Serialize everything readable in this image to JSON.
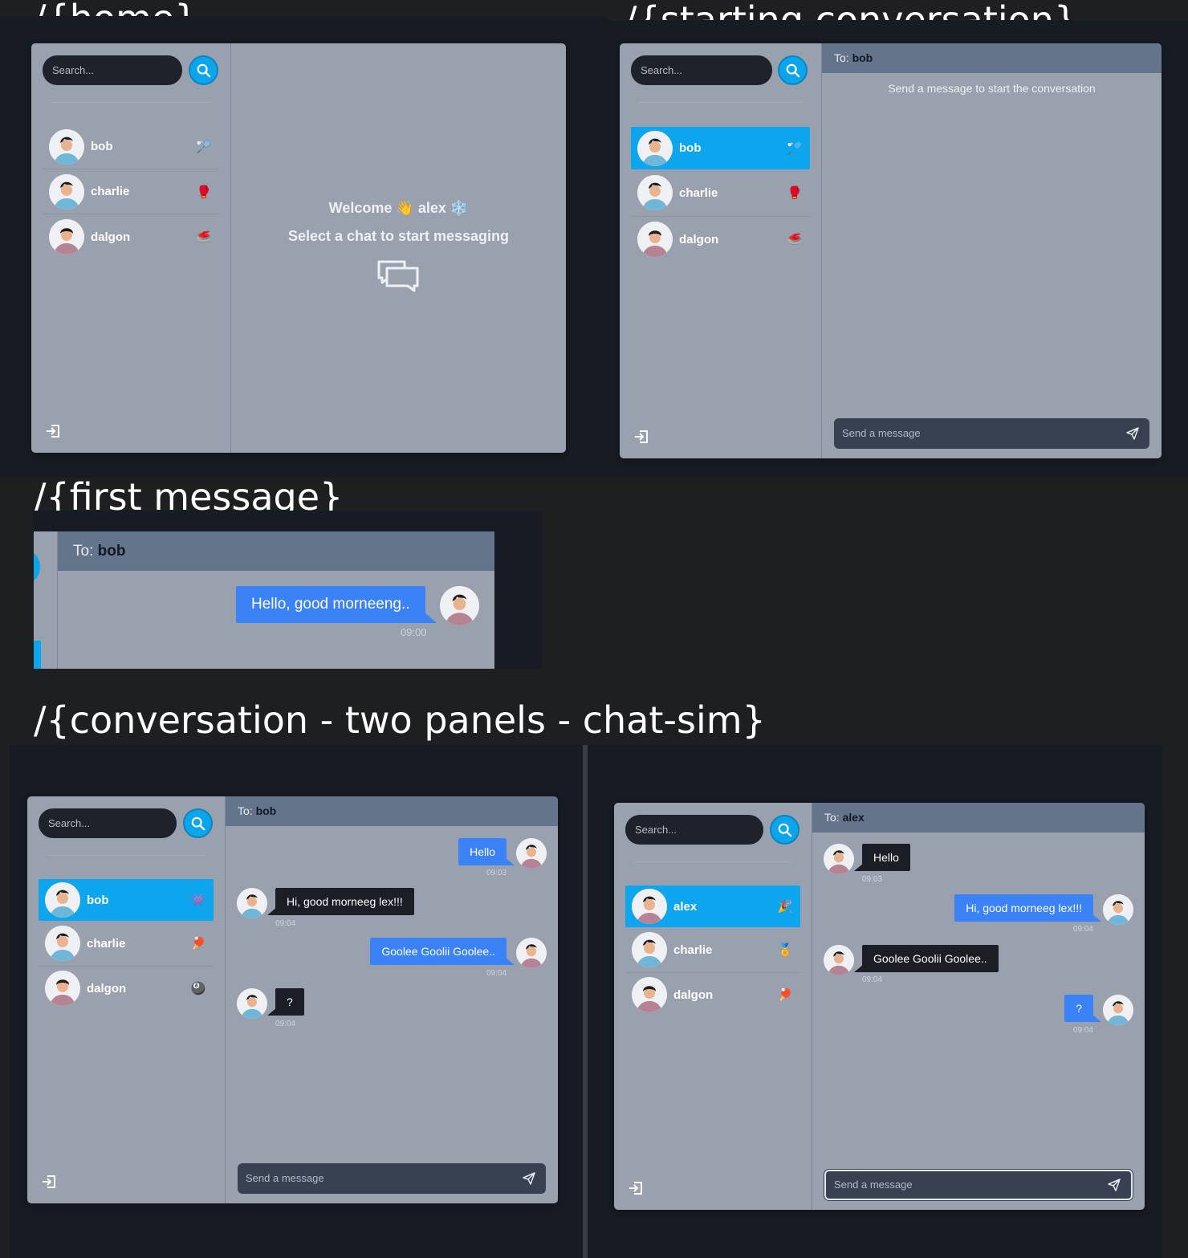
{
  "sections": {
    "home": "/{home}",
    "starting": "/{starting conversation}",
    "first": "/{first message}",
    "conversation": "/{conversation - two panels - chat-sim}"
  },
  "search": {
    "placeholder": "Search..."
  },
  "composer": {
    "placeholder": "Send a message"
  },
  "home": {
    "welcome_label": "Welcome",
    "wave_emoji": "👋",
    "user": "alex",
    "user_emoji": "❄️",
    "subtitle": "Select a chat to start messaging",
    "contacts": [
      {
        "name": "bob",
        "emoji": "🏸"
      },
      {
        "name": "charlie",
        "emoji": "🥊"
      },
      {
        "name": "dalgon",
        "emoji": "🥌"
      }
    ]
  },
  "starting": {
    "to_label": "To:",
    "to_name": "bob",
    "empty_text": "Send a message to start the conversation",
    "contacts": [
      {
        "name": "bob",
        "emoji": "🏸"
      },
      {
        "name": "charlie",
        "emoji": "🥊"
      },
      {
        "name": "dalgon",
        "emoji": "🥌"
      }
    ]
  },
  "first": {
    "to_label": "To:",
    "to_name": "bob",
    "message": "Hello, good morneeng..",
    "time": "09:00"
  },
  "panel_left": {
    "to_label": "To:",
    "to_name": "bob",
    "contacts": [
      {
        "name": "bob",
        "emoji": "👾"
      },
      {
        "name": "charlie",
        "emoji": "🏓"
      },
      {
        "name": "dalgon",
        "emoji": "🎱"
      }
    ],
    "messages": [
      {
        "dir": "out",
        "text": "Hello",
        "time": "09:03"
      },
      {
        "dir": "in",
        "text": "Hi, good morneeg lex!!!",
        "time": "09:04"
      },
      {
        "dir": "out",
        "text": "Goolee Goolii Goolee..",
        "time": "09:04"
      },
      {
        "dir": "in",
        "text": "?",
        "time": "09:04"
      }
    ]
  },
  "panel_right": {
    "to_label": "To:",
    "to_name": "alex",
    "contacts": [
      {
        "name": "alex",
        "emoji": "🎉"
      },
      {
        "name": "charlie",
        "emoji": "🏅"
      },
      {
        "name": "dalgon",
        "emoji": "🏓"
      }
    ],
    "messages": [
      {
        "dir": "in",
        "text": "Hello",
        "time": "09:03"
      },
      {
        "dir": "out",
        "text": "Hi, good morneeg lex!!!",
        "time": "09:04"
      },
      {
        "dir": "in",
        "text": "Goolee Goolii Goolee..",
        "time": "09:04"
      },
      {
        "dir": "out",
        "text": "?",
        "time": "09:04"
      }
    ]
  }
}
